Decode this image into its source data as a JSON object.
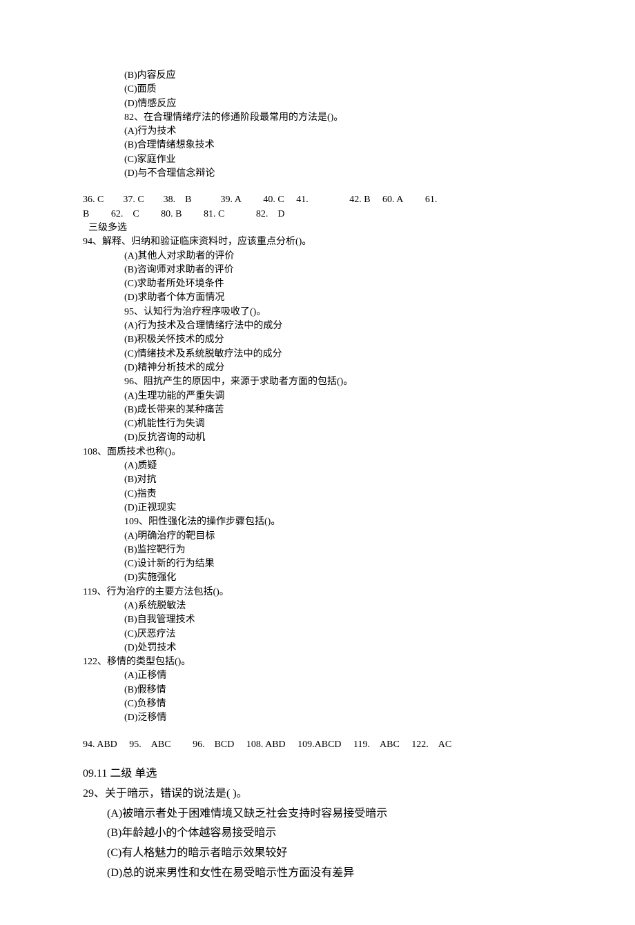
{
  "top": {
    "optB": "(B)内容反应",
    "optC": "(C)面质",
    "optD": "(D)情感反应",
    "q82": "82、在合理情绪疗法的修通阶段最常用的方法是()。",
    "q82a": "(A)行为技术",
    "q82b": "(B)合理情绪想象技术",
    "q82c": "(C)家庭作业",
    "q82d": "(D)与不合理信念辩论"
  },
  "answers1a": "36. C  37. C  38. B   39. A   40. C  41.     42. B  60. A   61.",
  "answers1b": "B   62. C   80. B   81. C    82. D",
  "sectionMulti": " 三级多选",
  "q94": "94、解释、归纳和验证临床资料时，应该重点分析()。",
  "q94a": "(A)其他人对求助者的评价",
  "q94b": "(B)咨询师对求助者的评价",
  "q94c": "(C)求助者所处环境条件",
  "q94d": "(D)求助者个体方面情况",
  "q95": "95、认知行为治疗程序吸收了()。",
  "q95a": "(A)行为技术及合理情绪疗法中的成分",
  "q95b": "(B)积极关怀技术的成分",
  "q95c": "(C)情绪技术及系统脱敏疗法中的成分",
  "q95d": "(D)精神分析技术的成分",
  "q96": "96、阻抗产生的原因中，来源于求助者方面的包括()。",
  "q96a": "(A)生理功能的严重失调",
  "q96b": "(B)成长带来的某种痛苦",
  "q96c": "(C)机能性行为失调",
  "q96d": "(D)反抗咨询的动机",
  "q108": "108、面质技术也称()。",
  "q108a": "(A)质疑",
  "q108b": "(B)对抗",
  "q108c": "(C)指责",
  "q108d": "(D)正视现实",
  "q109": "109、阳性强化法的操作步骤包括()。",
  "q109a": "(A)明确治疗的靶目标",
  "q109b": "(B)监控靶行为",
  "q109c": "(C)设计新的行为结果",
  "q109d": "(D)实施强化",
  "q119": "119、行为治疗的主要方法包括()。",
  "q119a": "(A)系统脱敏法",
  "q119b": "(B)自我管理技术",
  "q119c": "(C)厌恶疗法",
  "q119d": "(D)处罚技术",
  "q122": "122、移情的类型包括()。",
  "q122a": "(A)正移情",
  "q122b": "(B)假移情",
  "q122c": "(C)负移情",
  "q122d": "(D)泛移情",
  "answers2": "94. ABD  95. ABC   96. BCD  108. ABD  109.ABCD  119. ABC  122. AC",
  "section2": "09.11 二级  单选",
  "q29": "29、关于暗示，错误的说法是( )。",
  "q29a": "(A)被暗示者处于困难情境又缺乏社会支持时容易接受暗示",
  "q29b": "(B)年龄越小的个体越容易接受暗示",
  "q29c": "(C)有人格魅力的暗示者暗示效果较好",
  "q29d": "(D)总的说来男性和女性在易受暗示性方面没有差异"
}
